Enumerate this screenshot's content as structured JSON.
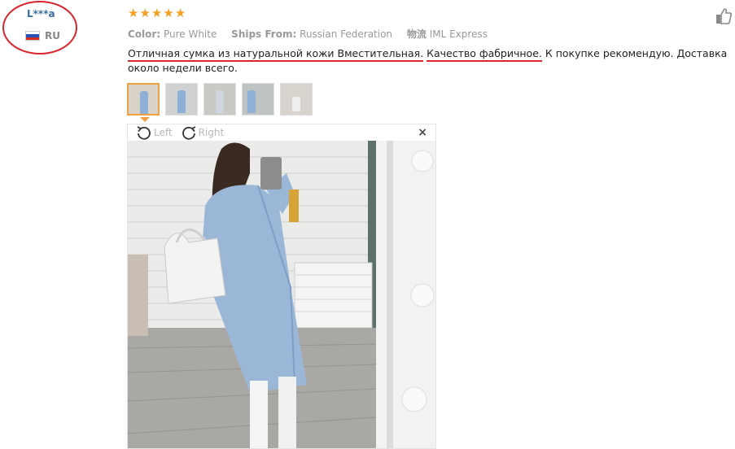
{
  "user": {
    "name": "L***a",
    "country": "RU"
  },
  "review": {
    "stars": [
      "★",
      "★",
      "★",
      "★",
      "★"
    ],
    "color_label": "Color:",
    "color_value": "Pure White",
    "ships_label": "Ships From:",
    "ships_value": "Russian Federation",
    "logistics_label": "物流",
    "logistics_value": "IML Express",
    "text_part1": "Отличная сумка из натуральной кожи Вместительная.",
    "text_part2": "Качество фабричное.",
    "text_part3": " К покупке рекомендую. Доставка около недели всего."
  },
  "viewer": {
    "rotate_left_label": "Left",
    "rotate_right_label": "Right",
    "close_label": "×"
  },
  "colors": {
    "annotation_red": "#d9252b",
    "star": "#f3a022",
    "link_blue": "#3a6e9e"
  },
  "icons": [
    "thumbs-up-icon",
    "rotate-left-icon",
    "rotate-right-icon",
    "close-icon",
    "russia-flag-icon",
    "star-icon"
  ]
}
